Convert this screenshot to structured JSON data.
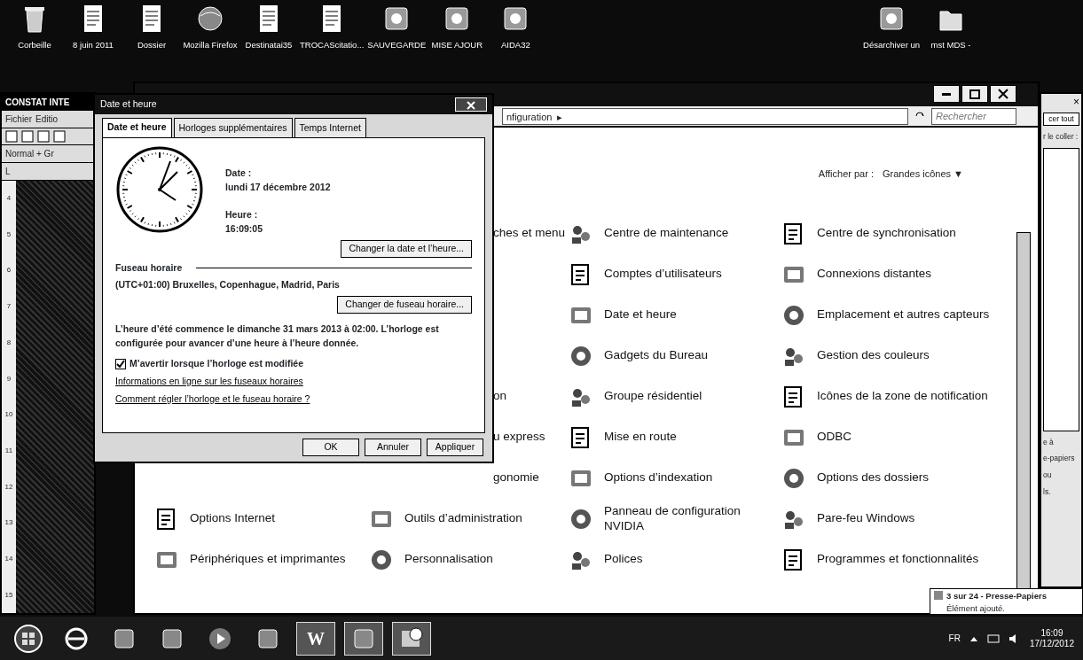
{
  "desktop_icons": [
    {
      "label": "Corbeille",
      "kind": "bin"
    },
    {
      "label": "8 juin 2011",
      "kind": "doc"
    },
    {
      "label": "Dossier",
      "kind": "doc"
    },
    {
      "label": "Mozilla Firefox",
      "kind": "globe"
    },
    {
      "label": "Destinatai35",
      "kind": "doc"
    },
    {
      "label": "TROCAScitatio...",
      "kind": "doc"
    },
    {
      "label": "SAUVEGARDE",
      "kind": "app"
    },
    {
      "label": "MISE AJOUR",
      "kind": "app"
    },
    {
      "label": "AIDA32",
      "kind": "app"
    },
    {
      "label": "Désarchiver un",
      "kind": "app"
    },
    {
      "label": "mst MDS -",
      "kind": "folder"
    }
  ],
  "word_window": {
    "title": "CONSTAT INTE",
    "menu": [
      "Fichier",
      "Editio"
    ],
    "style": "Normal + Gr",
    "tab_marker": "L",
    "ruler": [
      "4",
      "5",
      "6",
      "7",
      "8",
      "9",
      "10",
      "11",
      "12",
      "13",
      "14",
      "15"
    ]
  },
  "control_panel": {
    "breadcrumb": "nfiguration",
    "breadcrumb_arrow": "▸",
    "search": {
      "placeholder": "Rechercher"
    },
    "view_by_label": "Afficher par :",
    "view_by_value": "Grandes icônes",
    "view_by_caret": "▼",
    "rows": [
      [
        null,
        {
          "label": "ches et menu",
          "kind": "partial"
        },
        {
          "label": "Centre de maintenance",
          "kind": "item"
        },
        {
          "label": "Centre de synchronisation",
          "kind": "item"
        }
      ],
      [
        null,
        null,
        {
          "label": "Comptes d’utilisateurs",
          "kind": "item"
        },
        {
          "label": "Connexions distantes",
          "kind": "item"
        }
      ],
      [
        null,
        null,
        {
          "label": "Date et heure",
          "kind": "item"
        },
        {
          "label": "Emplacement et autres capteurs",
          "kind": "item"
        }
      ],
      [
        null,
        null,
        {
          "label": "Gadgets du Bureau",
          "kind": "item"
        },
        {
          "label": "Gestion des couleurs",
          "kind": "item"
        }
      ],
      [
        null,
        {
          "label": "on",
          "kind": "partial"
        },
        {
          "label": "Groupe résidentiel",
          "kind": "item"
        },
        {
          "label": "Icônes de la zone de notification",
          "kind": "item"
        }
      ],
      [
        null,
        {
          "label": "u express",
          "kind": "partial"
        },
        {
          "label": "Mise en route",
          "kind": "item"
        },
        {
          "label": "ODBC",
          "kind": "item"
        }
      ],
      [
        null,
        {
          "label": "gonomie",
          "kind": "partial"
        },
        {
          "label": "Options d’indexation",
          "kind": "item"
        },
        {
          "label": "Options des dossiers",
          "kind": "item"
        }
      ],
      [
        {
          "label": "Options Internet",
          "kind": "item"
        },
        {
          "label": "Outils d’administration",
          "kind": "item"
        },
        {
          "label": "Panneau de configuration NVIDIA",
          "kind": "item"
        },
        {
          "label": "Pare-feu Windows",
          "kind": "item"
        }
      ],
      [
        {
          "label": "Périphériques et imprimantes",
          "kind": "item"
        },
        {
          "label": "Personnalisation",
          "kind": "item"
        },
        {
          "label": "Polices",
          "kind": "item"
        },
        {
          "label": "Programmes et fonctionnalités",
          "kind": "item"
        }
      ]
    ]
  },
  "dialog": {
    "title": "Date et heure",
    "tabs": [
      {
        "label": "Date et heure",
        "selected": true
      },
      {
        "label": "Horloges supplémentaires",
        "selected": false
      },
      {
        "label": "Temps Internet",
        "selected": false
      }
    ],
    "date_label": "Date :",
    "date": "lundi 17 décembre 2012",
    "time_label": "Heure :",
    "time": "16:09:05",
    "change_datetime": "Changer la date et l’heure...",
    "timezone_heading": "Fuseau horaire",
    "timezone": "(UTC+01:00) Bruxelles, Copenhague, Madrid, Paris",
    "change_timezone": "Changer de fuseau horaire...",
    "dst_note": "L’heure d’été commence le dimanche 31 mars 2013 à 02:00. L’horloge est configurée pour avancer d’une heure à l’heure donnée.",
    "notify": {
      "label": "M’avertir lorsque l’horloge est modifiée",
      "checked": true
    },
    "links": [
      "Informations en ligne sur les fuseaux horaires",
      "Comment régler l’horloge et le fuseau horaire ?"
    ],
    "buttons": [
      "OK",
      "Annuler",
      "Appliquer"
    ]
  },
  "clipboard_pane": {
    "close_glyph": "×",
    "button": "cer tout",
    "label": "r le coller :",
    "texts": [
      "e à",
      "e-papiers",
      "ou",
      "ls."
    ]
  },
  "notification": {
    "title": "3 sur 24 - Presse-Papiers",
    "text": "Élément ajouté."
  },
  "taskbar": {
    "apps": [
      {
        "kind": "browser",
        "open": false
      },
      {
        "kind": "app",
        "open": false
      },
      {
        "kind": "app",
        "open": false
      },
      {
        "kind": "media",
        "open": false
      },
      {
        "kind": "app",
        "open": false
      },
      {
        "kind": "word",
        "glyph": "W",
        "open": true
      },
      {
        "kind": "app",
        "open": true
      },
      {
        "kind": "clock",
        "open": true
      }
    ],
    "language": "FR",
    "time": "16:09",
    "date": "17/12/2012"
  }
}
